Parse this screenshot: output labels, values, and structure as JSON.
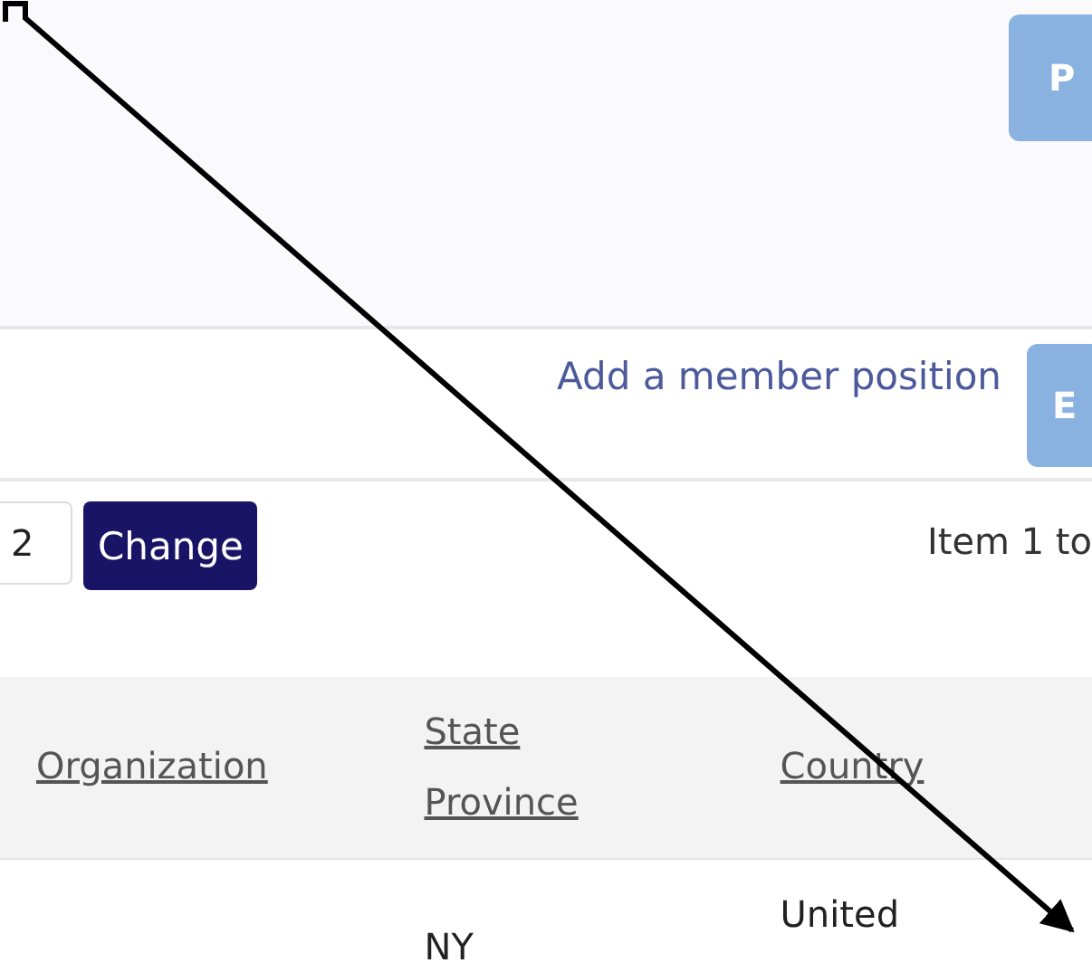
{
  "top_panel": {
    "button": "P"
  },
  "member_bar": {
    "link": "Add a member position",
    "button": "E"
  },
  "paging": {
    "page_size": "2",
    "button": "Change",
    "item_range": "Item 1 to"
  },
  "table": {
    "columns": [
      "Organization",
      "State Province",
      "Country"
    ],
    "rows": [
      {
        "cells": [
          "",
          "NY",
          "United"
        ]
      }
    ]
  },
  "annotation": {
    "kind": "arrow"
  }
}
